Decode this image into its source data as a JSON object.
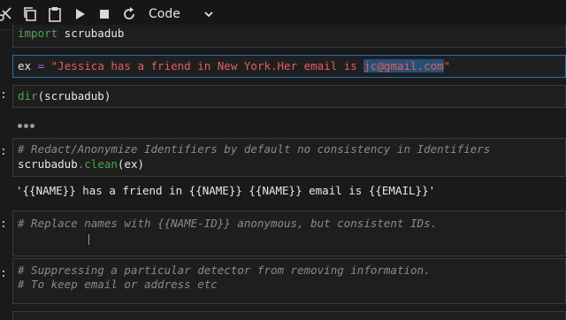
{
  "toolbar": {
    "cell_type": "Code",
    "icons": [
      "cut-icon",
      "copy-icon",
      "paste-icon",
      "run-icon",
      "stop-icon",
      "restart-icon",
      "chevron-down-icon"
    ]
  },
  "cells": {
    "import": {
      "kw": "import",
      "rest": " scrubadub"
    },
    "ex": {
      "var": "ex",
      "op": " = ",
      "str_a": "\"Jessica has a friend in New York.Her email is ",
      "str_hl": "jc@gmail.com",
      "str_b": "\""
    },
    "dir": {
      "fn": "dir",
      "rest": "(scrubadub)",
      "prompt": ":"
    },
    "clean": {
      "prompt": ":",
      "comment": "# Redact/Anonymize Identifiers by default no consistency in Identifiers",
      "call_a": "scrubadub",
      "call_b": ".",
      "call_fn": "clean",
      "call_c": "(ex)",
      "output": "'{{NAME}} has a friend in {{NAME}} {{NAME}} email is {{EMAIL}}'"
    },
    "replace": {
      "prompt": ":",
      "comment": "# Replace names with {{NAME-ID}} anonymous, but consistent IDs."
    },
    "suppress": {
      "prompt": ":",
      "comment1": "# Suppressing a particular detector from removing information.",
      "comment2": "# To keep email or address etc"
    }
  }
}
